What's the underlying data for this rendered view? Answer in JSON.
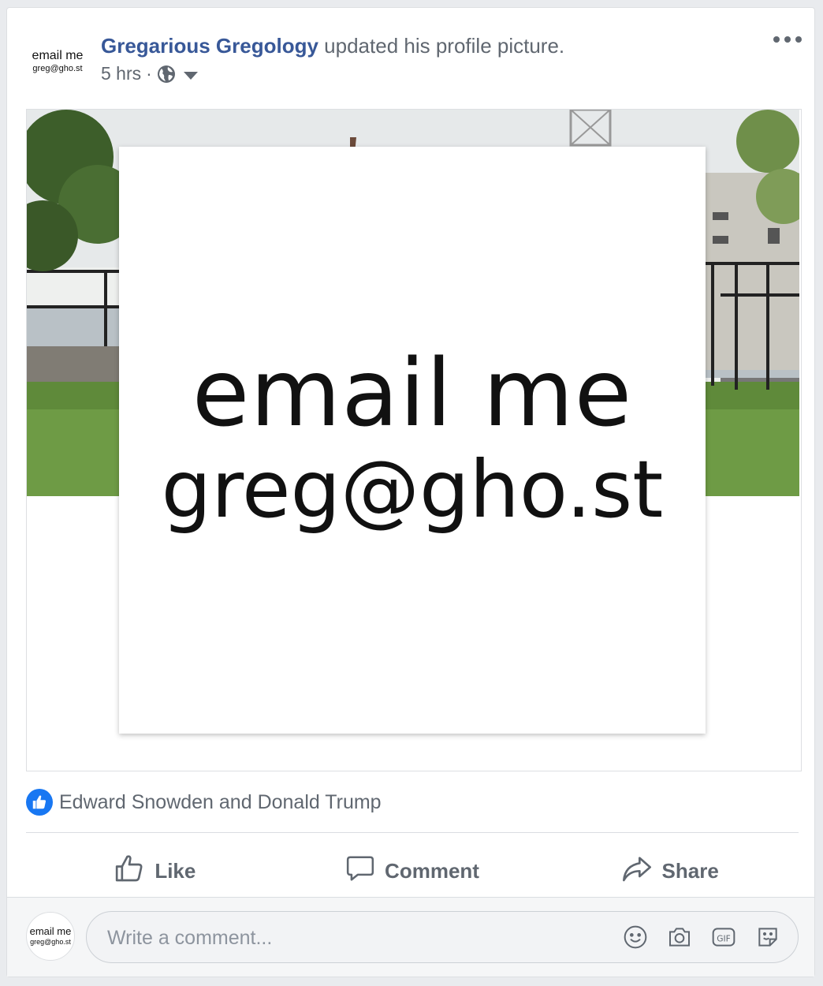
{
  "post": {
    "avatar_line1": "email me",
    "avatar_line2": "greg@gho.st",
    "author": "Gregarious Gregology",
    "action_text": " updated his profile picture.",
    "time": "5 hrs",
    "separator": "·",
    "privacy_icon": "globe-icon",
    "more_icon": "more-options-icon"
  },
  "photo": {
    "profile_line1": "email me",
    "profile_line2": "greg@gho.st"
  },
  "reactions": {
    "icon": "like-reaction-icon",
    "text": "Edward Snowden and Donald Trump"
  },
  "actions": {
    "like": "Like",
    "comment": "Comment",
    "share": "Share"
  },
  "comment": {
    "avatar_line1": "email me",
    "avatar_line2": "greg@gho.st",
    "placeholder": "Write a comment...",
    "icons": [
      "emoji-icon",
      "camera-icon",
      "gif-icon",
      "sticker-icon"
    ]
  },
  "colors": {
    "link": "#385898",
    "muted": "#606770",
    "like_blue": "#1877f2"
  }
}
